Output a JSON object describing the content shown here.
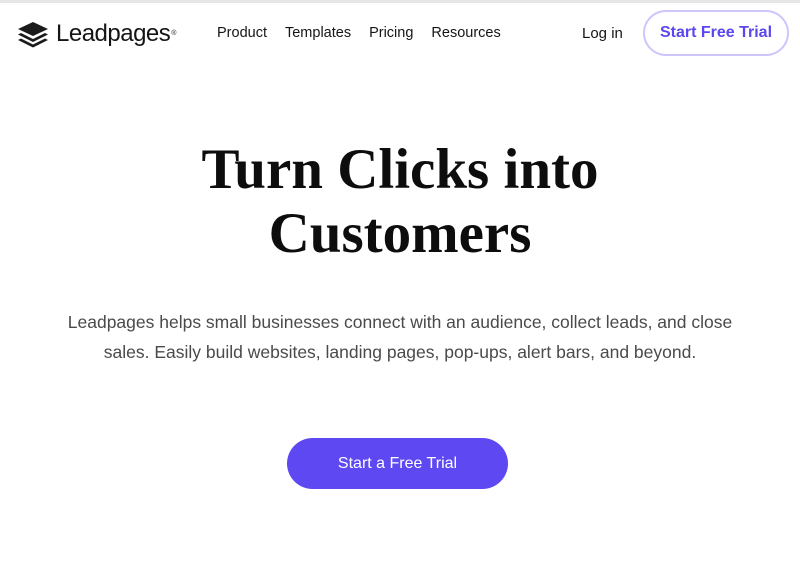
{
  "brand": {
    "name": "Leadpages",
    "trademark": "®",
    "logo_icon": "stacked-layers-icon",
    "accent_color": "#5d48f2",
    "outline_border_color": "#cfc6fb"
  },
  "nav": {
    "links": [
      "Product",
      "Templates",
      "Pricing",
      "Resources"
    ],
    "login_label": "Log in",
    "trial_label": "Start Free Trial"
  },
  "hero": {
    "title_line1": "Turn Clicks into",
    "title_line2": "Customers",
    "subtitle": "Leadpages helps small businesses connect with an audience, collect leads, and close sales. Easily build websites, landing pages, pop-ups, alert bars, and beyond.",
    "cta_label": "Start a Free Trial"
  }
}
